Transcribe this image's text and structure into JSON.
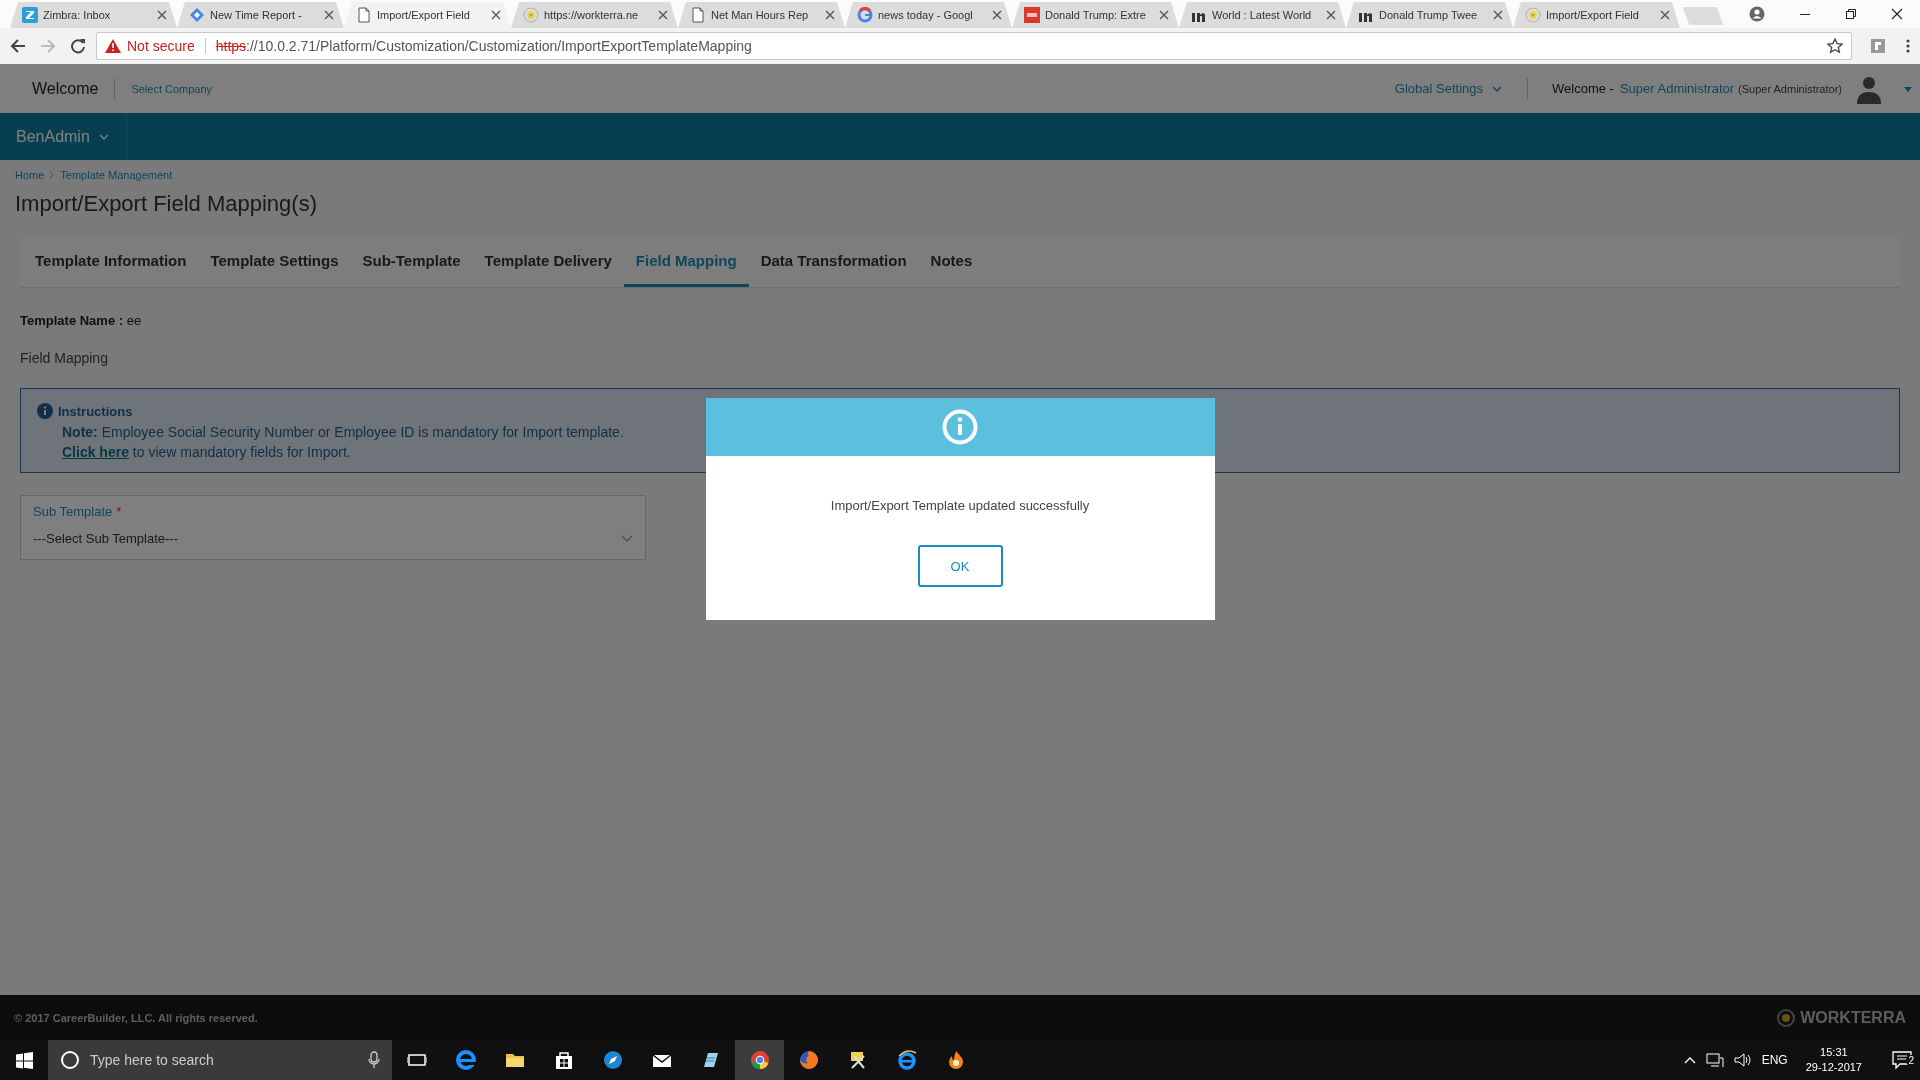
{
  "browser": {
    "tabs": [
      {
        "title": "Zimbra: Inbox",
        "selected": false
      },
      {
        "title": "New Time Report -",
        "selected": false
      },
      {
        "title": "Import/Export Field",
        "selected": true
      },
      {
        "title": "https://workterra.ne",
        "selected": false
      },
      {
        "title": "Net Man Hours Rep",
        "selected": false
      },
      {
        "title": "news today - Googl",
        "selected": false
      },
      {
        "title": "Donald Trump: Extre",
        "selected": false
      },
      {
        "title": "World : Latest World",
        "selected": false
      },
      {
        "title": "Donald Trump Twee",
        "selected": false
      },
      {
        "title": "Import/Export Field",
        "selected": false
      }
    ],
    "security": "Not secure",
    "url_scheme": "https",
    "url_rest": "://10.0.2.71/Platform/Customization/Customization/ImportExportTemplateMapping"
  },
  "header": {
    "welcome": "Welcome",
    "select_company": "Select Company",
    "global_settings": "Global Settings",
    "user_welcome": "Welcome -",
    "user_name": "Super Administrator",
    "user_role": "(Super Administrator)"
  },
  "nav": {
    "menu": "BenAdmin"
  },
  "breadcrumb": [
    "Home",
    "Template Management"
  ],
  "page_title": "Import/Export Field Mapping(s)",
  "tabs": [
    {
      "label": "Template Information",
      "selected": false
    },
    {
      "label": "Template Settings",
      "selected": false
    },
    {
      "label": "Sub-Template",
      "selected": false
    },
    {
      "label": "Template Delivery",
      "selected": false
    },
    {
      "label": "Field Mapping",
      "selected": true
    },
    {
      "label": "Data Transformation",
      "selected": false
    },
    {
      "label": "Notes",
      "selected": false
    }
  ],
  "template_name": {
    "label": "Template Name :",
    "value": "ee"
  },
  "section_title": "Field Mapping",
  "instructions": {
    "title": "Instructions",
    "note": "**Note:** Employee Social Security Number or Employee ID is mandatory for Import template.",
    "link": "Click here",
    "link_rest": "to view mandatory fields for Import."
  },
  "sub_template": {
    "label": "Sub Template",
    "required_mark": "*",
    "placeholder": "---Select Sub Template---"
  },
  "dialog": {
    "message": "Import/Export Template updated successfully",
    "button": "OK"
  },
  "footer": {
    "copyright": "© 2017 CareerBuilder, LLC. All rights reserved.",
    "brand": "WORKTERRA"
  },
  "taskbar": {
    "search_placeholder": "Type here to search",
    "apps": [
      {
        "selected": false
      },
      {
        "selected": false
      },
      {
        "selected": false
      },
      {
        "selected": false
      },
      {
        "selected": false
      },
      {
        "selected": false
      },
      {
        "selected": false
      },
      {
        "selected": true
      },
      {
        "selected": false
      },
      {
        "selected": false
      },
      {
        "selected": false
      },
      {
        "selected": false
      }
    ],
    "language": "ENG",
    "time": "15:31",
    "date": "29-12-2017",
    "notifications": "2"
  }
}
